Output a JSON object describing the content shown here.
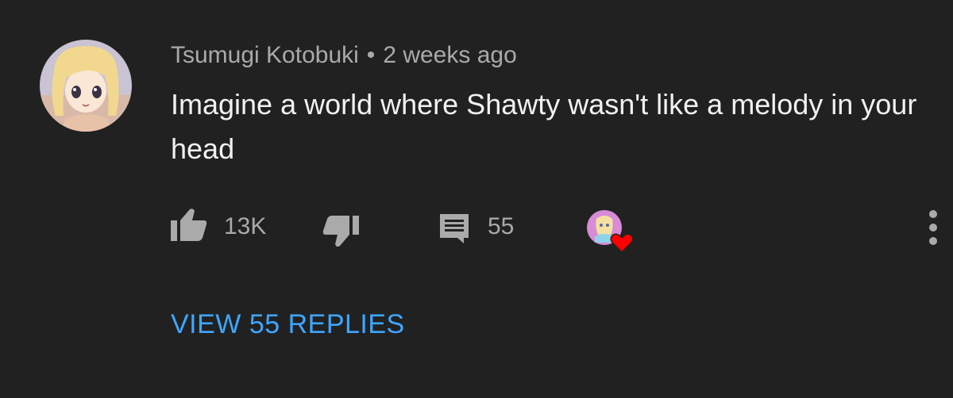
{
  "comment": {
    "author": "Tsumugi Kotobuki",
    "separator": "•",
    "timestamp": "2 weeks ago",
    "text": "Imagine a world where Shawty wasn't like a melody in your head",
    "avatar_icon": "anime-girl-avatar"
  },
  "actions": {
    "like_icon": "thumbs-up-icon",
    "like_count": "13K",
    "dislike_icon": "thumbs-down-icon",
    "reply_icon": "comment-icon",
    "reply_count": "55",
    "creator_heart_icon": "creator-heart-icon",
    "more_icon": "more-vertical-icon"
  },
  "replies": {
    "view_label": "VIEW 55 REPLIES"
  },
  "colors": {
    "background": "#212121",
    "meta_text": "#aaaaaa",
    "body_text": "#f1f1f1",
    "link": "#3ea6ff",
    "heart": "#ff0000"
  }
}
